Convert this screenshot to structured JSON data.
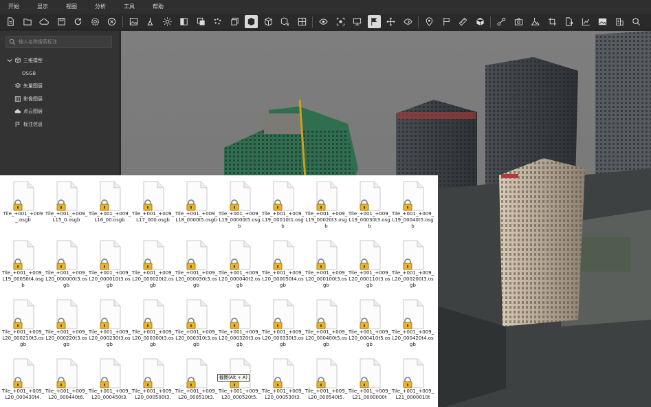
{
  "menu": [
    "开始",
    "显示",
    "视图",
    "分析",
    "工具",
    "帮助"
  ],
  "toolbar": {
    "groups": [
      [
        "new-file-icon",
        "open-folder-icon",
        "cloud-icon",
        "save-icon",
        "refresh-icon",
        "settings-icon",
        "close-circle-icon"
      ],
      [
        "photo-scene-icon",
        "lighting-icon",
        "sun-icon",
        "contrast-icon",
        "layer-mask-icon",
        "point-cloud-icon",
        "stack-pages-icon",
        "cube-solid-icon",
        "cube-outline-icon",
        "cube-remove-icon",
        "grid-select-icon"
      ],
      [
        "eye-rotate-icon",
        "frame-select-icon",
        "monitor-icon",
        "flag-route-icon",
        "move-cross-icon",
        "eye-follow-icon"
      ],
      [
        "location-pin-icon",
        "flag-icon",
        "ruler-icon",
        "box-3d-icon"
      ],
      [
        "route-path-icon",
        "camera-icon",
        "terrain-measure-icon",
        "crop-icon",
        "export-file-icon",
        "chart-line-icon",
        "image-icon",
        "building-icon",
        "search-icon"
      ]
    ],
    "active": [
      "cube-solid-icon",
      "flag-route-icon"
    ]
  },
  "panel": {
    "search_placeholder": "输入名称搜索标注",
    "tree": [
      {
        "label": "三维模型",
        "icon": "cube-icon",
        "indent": 0,
        "expanded": true
      },
      {
        "label": "OSGB",
        "icon": "",
        "indent": 1
      },
      {
        "label": "矢量图层",
        "icon": "vector-layer-icon",
        "indent": 0
      },
      {
        "label": "影像图层",
        "icon": "image-layer-icon",
        "indent": 0
      },
      {
        "label": "点云图层",
        "icon": "cloud-layer-icon",
        "indent": 0
      },
      {
        "label": "标注信息",
        "icon": "annotation-icon",
        "indent": 0
      }
    ]
  },
  "files": [
    [
      "Tile_+001_+009_.osgb",
      "Tile_+001_+009_L15_0.osgb",
      "Tile_+001_+009_L16_00.osgb",
      "Tile_+001_+009_L17_000.osgb",
      "Tile_+001_+009_L18_0000t5.osgb",
      "Tile_+001_+009_L19_00000t5.osgb",
      "Tile_+001_+009_L19_00010t1.osgb",
      "Tile_+001_+009_L19_00020t3.osgb",
      "Tile_+001_+009_L19_00030t3.osgb",
      "Tile_+001_+009_L19_00040t5.osgb"
    ],
    [
      "Tile_+001_+009_L19_00050t4.osgb",
      "Tile_+001_+009_L20_000000t3.osgb",
      "Tile_+001_+009_L20_000010t3.osgb",
      "Tile_+001_+009_L20_000020t2.osgb",
      "Tile_+001_+009_L20_000030t3.osgb",
      "Tile_+001_+009_L20_000040t2.osgb",
      "Tile_+001_+009_L20_000050t4.osgb",
      "Tile_+001_+009_L20_000100t3.osgb",
      "Tile_+001_+009_L20_000110t3.osgb",
      "Tile_+001_+009_L20_000200t3.osgb"
    ],
    [
      "Tile_+001_+009_L20_000210t3.osgb",
      "Tile_+001_+009_L20_000220t3.osgb",
      "Tile_+001_+009_L20_000230t3.osgb",
      "Tile_+001_+009_L20_000300t3.osgb",
      "Tile_+001_+009_L20_000310t3.osgb",
      "Tile_+001_+009_L20_000320t3.osgb",
      "Tile_+001_+009_L20_000330t3.osgb",
      "Tile_+001_+009_L20_000400t5.osgb",
      "Tile_+001_+009_L20_000410t5.osgb",
      "Tile_+001_+009_L20_000420t4.osgb"
    ],
    [
      "Tile_+001_+009_L20_000430t4.",
      "Tile_+001_+009_L20_000440t6.",
      "Tile_+001_+009_L20_000450t3.",
      "Tile_+001_+009_L20_000500t3.",
      "Tile_+001_+009_L20_000510t3.",
      "Tile_+001_+009_L20_000520t5.",
      "Tile_+001_+009_L20_000530t3.",
      "Tile_+001_+009_L20_000540t5.",
      "Tile_+001_+009_L21_0000000t",
      "Tile_+001_+009_L21_0000010t"
    ]
  ],
  "tooltip": "截图(Alt + A)",
  "colors": {
    "ui_bg": "#2b2b2b",
    "panel": "#333333",
    "sky": "#7a7a7a",
    "active": "#d9d9d9",
    "lock": "#e8b52a"
  }
}
